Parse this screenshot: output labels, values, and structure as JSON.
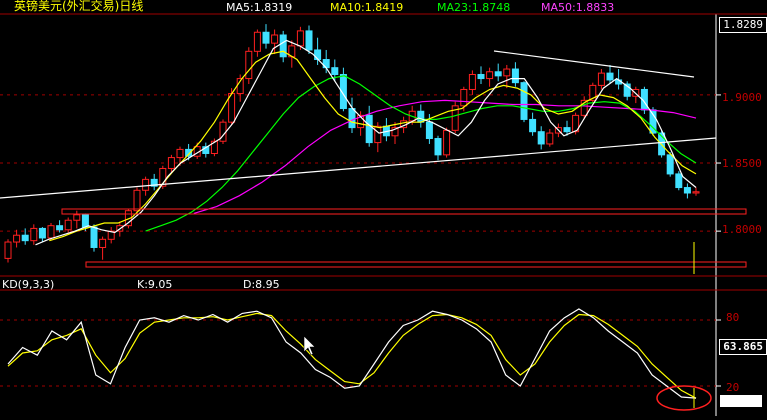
{
  "header": {
    "title": "英镑美元(外汇交易)日线",
    "ma5": "MA5:1.8319",
    "ma10": "MA10:1.8419",
    "ma23": "MA23:1.8748",
    "ma50": "MA50:1.8833"
  },
  "kd_header": {
    "name": "KD(9,3,3)",
    "k": "K:9.05",
    "d": "D:8.95"
  },
  "axis": {
    "top_value": "1.8289",
    "price_ticks": [
      "1.9000",
      "1.8500",
      "1.8000"
    ],
    "kd_value": "63.865",
    "kd_ticks": [
      "80",
      "20"
    ]
  },
  "colors": {
    "title": "#ffff00",
    "ma5": "#ffffff",
    "ma10": "#ffff00",
    "ma23": "#00ff00",
    "ma50": "#ff00ff",
    "bull": "#ff2020",
    "bear": "#40e0ff",
    "grid": "#a00000",
    "kd_k": "#ffffff",
    "kd_d": "#ffff00"
  },
  "chart_data": {
    "type": "candlestick",
    "title": "英镑美元(外汇交易)日线",
    "ylim": [
      1.77,
      1.955
    ],
    "price_ticks": [
      1.9,
      1.85,
      1.8
    ],
    "candles": [
      [
        1.78,
        1.794,
        1.777,
        1.792
      ],
      [
        1.792,
        1.801,
        1.788,
        1.797
      ],
      [
        1.797,
        1.802,
        1.79,
        1.793
      ],
      [
        1.793,
        1.805,
        1.79,
        1.802
      ],
      [
        1.802,
        1.803,
        1.792,
        1.795
      ],
      [
        1.795,
        1.806,
        1.793,
        1.804
      ],
      [
        1.804,
        1.808,
        1.799,
        1.801
      ],
      [
        1.801,
        1.81,
        1.799,
        1.808
      ],
      [
        1.808,
        1.815,
        1.802,
        1.812
      ],
      [
        1.812,
        1.813,
        1.8,
        1.803
      ],
      [
        1.803,
        1.805,
        1.785,
        1.788
      ],
      [
        1.788,
        1.796,
        1.779,
        1.794
      ],
      [
        1.794,
        1.803,
        1.791,
        1.8
      ],
      [
        1.8,
        1.807,
        1.796,
        1.804
      ],
      [
        1.804,
        1.816,
        1.802,
        1.815
      ],
      [
        1.815,
        1.832,
        1.812,
        1.83
      ],
      [
        1.83,
        1.84,
        1.826,
        1.838
      ],
      [
        1.838,
        1.842,
        1.83,
        1.833
      ],
      [
        1.833,
        1.848,
        1.831,
        1.846
      ],
      [
        1.846,
        1.856,
        1.843,
        1.854
      ],
      [
        1.854,
        1.862,
        1.848,
        1.86
      ],
      [
        1.86,
        1.864,
        1.852,
        1.855
      ],
      [
        1.855,
        1.865,
        1.853,
        1.862
      ],
      [
        1.862,
        1.865,
        1.854,
        1.857
      ],
      [
        1.857,
        1.868,
        1.855,
        1.866
      ],
      [
        1.866,
        1.882,
        1.864,
        1.88
      ],
      [
        1.88,
        1.905,
        1.878,
        1.901
      ],
      [
        1.901,
        1.915,
        1.895,
        1.912
      ],
      [
        1.912,
        1.935,
        1.908,
        1.932
      ],
      [
        1.932,
        1.948,
        1.928,
        1.946
      ],
      [
        1.946,
        1.952,
        1.934,
        1.938
      ],
      [
        1.938,
        1.948,
        1.93,
        1.944
      ],
      [
        1.944,
        1.947,
        1.924,
        1.928
      ],
      [
        1.928,
        1.94,
        1.92,
        1.936
      ],
      [
        1.936,
        1.95,
        1.933,
        1.947
      ],
      [
        1.947,
        1.951,
        1.93,
        1.933
      ],
      [
        1.933,
        1.942,
        1.922,
        1.926
      ],
      [
        1.926,
        1.933,
        1.916,
        1.92
      ],
      [
        1.92,
        1.926,
        1.91,
        1.915
      ],
      [
        1.915,
        1.92,
        1.888,
        1.89
      ],
      [
        1.89,
        1.898,
        1.872,
        1.876
      ],
      [
        1.876,
        1.888,
        1.87,
        1.885
      ],
      [
        1.885,
        1.892,
        1.862,
        1.865
      ],
      [
        1.865,
        1.88,
        1.858,
        1.877
      ],
      [
        1.877,
        1.883,
        1.866,
        1.87
      ],
      [
        1.87,
        1.88,
        1.864,
        1.876
      ],
      [
        1.876,
        1.884,
        1.872,
        1.881
      ],
      [
        1.881,
        1.892,
        1.878,
        1.888
      ],
      [
        1.888,
        1.893,
        1.876,
        1.88
      ],
      [
        1.88,
        1.886,
        1.864,
        1.868
      ],
      [
        1.868,
        1.87,
        1.852,
        1.856
      ],
      [
        1.856,
        1.876,
        1.854,
        1.874
      ],
      [
        1.874,
        1.895,
        1.872,
        1.892
      ],
      [
        1.892,
        1.906,
        1.888,
        1.904
      ],
      [
        1.904,
        1.918,
        1.9,
        1.915
      ],
      [
        1.915,
        1.921,
        1.908,
        1.912
      ],
      [
        1.912,
        1.92,
        1.906,
        1.917
      ],
      [
        1.917,
        1.923,
        1.91,
        1.914
      ],
      [
        1.914,
        1.922,
        1.905,
        1.919
      ],
      [
        1.919,
        1.924,
        1.906,
        1.909
      ],
      [
        1.909,
        1.91,
        1.88,
        1.882
      ],
      [
        1.882,
        1.887,
        1.87,
        1.873
      ],
      [
        1.873,
        1.877,
        1.86,
        1.864
      ],
      [
        1.864,
        1.875,
        1.862,
        1.872
      ],
      [
        1.872,
        1.879,
        1.869,
        1.876
      ],
      [
        1.876,
        1.881,
        1.87,
        1.873
      ],
      [
        1.873,
        1.887,
        1.871,
        1.885
      ],
      [
        1.885,
        1.899,
        1.883,
        1.896
      ],
      [
        1.896,
        1.909,
        1.894,
        1.907
      ],
      [
        1.907,
        1.919,
        1.904,
        1.916
      ],
      [
        1.916,
        1.922,
        1.908,
        1.911
      ],
      [
        1.911,
        1.919,
        1.904,
        1.908
      ],
      [
        1.908,
        1.91,
        1.896,
        1.899
      ],
      [
        1.899,
        1.906,
        1.894,
        1.904
      ],
      [
        1.904,
        1.906,
        1.886,
        1.889
      ],
      [
        1.889,
        1.891,
        1.87,
        1.872
      ],
      [
        1.872,
        1.874,
        1.854,
        1.856
      ],
      [
        1.856,
        1.858,
        1.84,
        1.842
      ],
      [
        1.842,
        1.844,
        1.83,
        1.832
      ],
      [
        1.832,
        1.835,
        1.824,
        1.828
      ],
      [
        1.828,
        1.832,
        1.826,
        1.8289
      ]
    ],
    "moving_averages": {
      "MA5": [
        1.79,
        1.794,
        1.797,
        1.8,
        1.804,
        1.801,
        1.799,
        1.806,
        1.814,
        1.826,
        1.84,
        1.85,
        1.856,
        1.862,
        1.868,
        1.88,
        1.898,
        1.916,
        1.934,
        1.94,
        1.936,
        1.93,
        1.92,
        1.905,
        1.89,
        1.88,
        1.872,
        1.874,
        1.878,
        1.883,
        1.88,
        1.875,
        1.87,
        1.88,
        1.896,
        1.908,
        1.912,
        1.912,
        1.898,
        1.88,
        1.87,
        1.874,
        1.89,
        1.905,
        1.912,
        1.905,
        1.896,
        1.882,
        1.862,
        1.84,
        1.832
      ],
      "MA10": [
        1.793,
        1.796,
        1.8,
        1.803,
        1.806,
        1.806,
        1.81,
        1.82,
        1.832,
        1.844,
        1.855,
        1.866,
        1.88,
        1.897,
        1.912,
        1.924,
        1.93,
        1.932,
        1.926,
        1.912,
        1.898,
        1.886,
        1.88,
        1.878,
        1.876,
        1.878,
        1.88,
        1.88,
        1.884,
        1.888,
        1.89,
        1.898,
        1.904,
        1.907,
        1.905,
        1.9,
        1.89,
        1.886,
        1.888,
        1.895,
        1.9,
        1.898,
        1.892,
        1.883,
        1.869,
        1.858,
        1.848,
        1.842
      ],
      "MA23": [
        1.8,
        1.804,
        1.808,
        1.814,
        1.822,
        1.832,
        1.844,
        1.858,
        1.872,
        1.886,
        1.898,
        1.906,
        1.912,
        1.914,
        1.908,
        1.9,
        1.892,
        1.886,
        1.882,
        1.882,
        1.884,
        1.887,
        1.89,
        1.892,
        1.892,
        1.89,
        1.888,
        1.888,
        1.89,
        1.894,
        1.895,
        1.894,
        1.888,
        1.878,
        1.867,
        1.857,
        1.85
      ],
      "MA50": [
        1.813,
        1.818,
        1.826,
        1.836,
        1.848,
        1.862,
        1.874,
        1.882,
        1.888,
        1.892,
        1.895,
        1.896,
        1.895,
        1.894,
        1.893,
        1.893,
        1.892,
        1.892,
        1.891,
        1.89,
        1.889,
        1.887,
        1.883
      ]
    },
    "kd": {
      "ylim": [
        0,
        100
      ],
      "ticks": [
        80,
        20
      ],
      "K": [
        40,
        55,
        48,
        70,
        62,
        78,
        30,
        22,
        55,
        80,
        82,
        78,
        84,
        80,
        85,
        78,
        86,
        88,
        82,
        60,
        50,
        35,
        28,
        18,
        20,
        40,
        60,
        75,
        80,
        88,
        85,
        80,
        72,
        60,
        30,
        20,
        45,
        70,
        82,
        90,
        82,
        70,
        60,
        50,
        30,
        20,
        10,
        9
      ],
      "D": [
        38,
        50,
        52,
        62,
        66,
        72,
        48,
        32,
        45,
        68,
        78,
        80,
        82,
        82,
        83,
        80,
        83,
        86,
        84,
        70,
        58,
        44,
        34,
        24,
        22,
        32,
        50,
        66,
        76,
        84,
        85,
        82,
        76,
        66,
        44,
        30,
        40,
        60,
        75,
        85,
        84,
        76,
        66,
        56,
        40,
        28,
        16,
        8.95
      ]
    }
  }
}
